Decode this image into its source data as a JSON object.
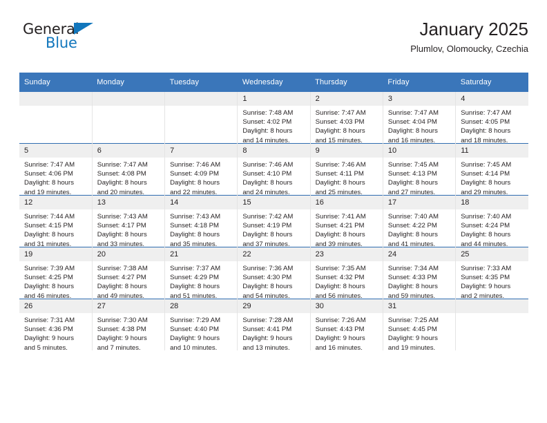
{
  "logo": {
    "text_primary": "General",
    "text_secondary": "Blue",
    "triangle_color": "#1176bc"
  },
  "header": {
    "title": "January 2025",
    "subtitle": "Plumlov, Olomoucky, Czechia"
  },
  "theme": {
    "header_bg": "#3a76ba",
    "row_divider": "#2e6cb0",
    "daynum_bg": "#efefef",
    "text": "#231f20"
  },
  "calendar": {
    "weekday_headers": [
      "Sunday",
      "Monday",
      "Tuesday",
      "Wednesday",
      "Thursday",
      "Friday",
      "Saturday"
    ],
    "weeks": [
      [
        {
          "day": "",
          "lines": []
        },
        {
          "day": "",
          "lines": []
        },
        {
          "day": "",
          "lines": []
        },
        {
          "day": "1",
          "lines": [
            "Sunrise: 7:48 AM",
            "Sunset: 4:02 PM",
            "Daylight: 8 hours",
            "and 14 minutes."
          ]
        },
        {
          "day": "2",
          "lines": [
            "Sunrise: 7:47 AM",
            "Sunset: 4:03 PM",
            "Daylight: 8 hours",
            "and 15 minutes."
          ]
        },
        {
          "day": "3",
          "lines": [
            "Sunrise: 7:47 AM",
            "Sunset: 4:04 PM",
            "Daylight: 8 hours",
            "and 16 minutes."
          ]
        },
        {
          "day": "4",
          "lines": [
            "Sunrise: 7:47 AM",
            "Sunset: 4:05 PM",
            "Daylight: 8 hours",
            "and 18 minutes."
          ]
        }
      ],
      [
        {
          "day": "5",
          "lines": [
            "Sunrise: 7:47 AM",
            "Sunset: 4:06 PM",
            "Daylight: 8 hours",
            "and 19 minutes."
          ]
        },
        {
          "day": "6",
          "lines": [
            "Sunrise: 7:47 AM",
            "Sunset: 4:08 PM",
            "Daylight: 8 hours",
            "and 20 minutes."
          ]
        },
        {
          "day": "7",
          "lines": [
            "Sunrise: 7:46 AM",
            "Sunset: 4:09 PM",
            "Daylight: 8 hours",
            "and 22 minutes."
          ]
        },
        {
          "day": "8",
          "lines": [
            "Sunrise: 7:46 AM",
            "Sunset: 4:10 PM",
            "Daylight: 8 hours",
            "and 24 minutes."
          ]
        },
        {
          "day": "9",
          "lines": [
            "Sunrise: 7:46 AM",
            "Sunset: 4:11 PM",
            "Daylight: 8 hours",
            "and 25 minutes."
          ]
        },
        {
          "day": "10",
          "lines": [
            "Sunrise: 7:45 AM",
            "Sunset: 4:13 PM",
            "Daylight: 8 hours",
            "and 27 minutes."
          ]
        },
        {
          "day": "11",
          "lines": [
            "Sunrise: 7:45 AM",
            "Sunset: 4:14 PM",
            "Daylight: 8 hours",
            "and 29 minutes."
          ]
        }
      ],
      [
        {
          "day": "12",
          "lines": [
            "Sunrise: 7:44 AM",
            "Sunset: 4:15 PM",
            "Daylight: 8 hours",
            "and 31 minutes."
          ]
        },
        {
          "day": "13",
          "lines": [
            "Sunrise: 7:43 AM",
            "Sunset: 4:17 PM",
            "Daylight: 8 hours",
            "and 33 minutes."
          ]
        },
        {
          "day": "14",
          "lines": [
            "Sunrise: 7:43 AM",
            "Sunset: 4:18 PM",
            "Daylight: 8 hours",
            "and 35 minutes."
          ]
        },
        {
          "day": "15",
          "lines": [
            "Sunrise: 7:42 AM",
            "Sunset: 4:19 PM",
            "Daylight: 8 hours",
            "and 37 minutes."
          ]
        },
        {
          "day": "16",
          "lines": [
            "Sunrise: 7:41 AM",
            "Sunset: 4:21 PM",
            "Daylight: 8 hours",
            "and 39 minutes."
          ]
        },
        {
          "day": "17",
          "lines": [
            "Sunrise: 7:40 AM",
            "Sunset: 4:22 PM",
            "Daylight: 8 hours",
            "and 41 minutes."
          ]
        },
        {
          "day": "18",
          "lines": [
            "Sunrise: 7:40 AM",
            "Sunset: 4:24 PM",
            "Daylight: 8 hours",
            "and 44 minutes."
          ]
        }
      ],
      [
        {
          "day": "19",
          "lines": [
            "Sunrise: 7:39 AM",
            "Sunset: 4:25 PM",
            "Daylight: 8 hours",
            "and 46 minutes."
          ]
        },
        {
          "day": "20",
          "lines": [
            "Sunrise: 7:38 AM",
            "Sunset: 4:27 PM",
            "Daylight: 8 hours",
            "and 49 minutes."
          ]
        },
        {
          "day": "21",
          "lines": [
            "Sunrise: 7:37 AM",
            "Sunset: 4:29 PM",
            "Daylight: 8 hours",
            "and 51 minutes."
          ]
        },
        {
          "day": "22",
          "lines": [
            "Sunrise: 7:36 AM",
            "Sunset: 4:30 PM",
            "Daylight: 8 hours",
            "and 54 minutes."
          ]
        },
        {
          "day": "23",
          "lines": [
            "Sunrise: 7:35 AM",
            "Sunset: 4:32 PM",
            "Daylight: 8 hours",
            "and 56 minutes."
          ]
        },
        {
          "day": "24",
          "lines": [
            "Sunrise: 7:34 AM",
            "Sunset: 4:33 PM",
            "Daylight: 8 hours",
            "and 59 minutes."
          ]
        },
        {
          "day": "25",
          "lines": [
            "Sunrise: 7:33 AM",
            "Sunset: 4:35 PM",
            "Daylight: 9 hours",
            "and 2 minutes."
          ]
        }
      ],
      [
        {
          "day": "26",
          "lines": [
            "Sunrise: 7:31 AM",
            "Sunset: 4:36 PM",
            "Daylight: 9 hours",
            "and 5 minutes."
          ]
        },
        {
          "day": "27",
          "lines": [
            "Sunrise: 7:30 AM",
            "Sunset: 4:38 PM",
            "Daylight: 9 hours",
            "and 7 minutes."
          ]
        },
        {
          "day": "28",
          "lines": [
            "Sunrise: 7:29 AM",
            "Sunset: 4:40 PM",
            "Daylight: 9 hours",
            "and 10 minutes."
          ]
        },
        {
          "day": "29",
          "lines": [
            "Sunrise: 7:28 AM",
            "Sunset: 4:41 PM",
            "Daylight: 9 hours",
            "and 13 minutes."
          ]
        },
        {
          "day": "30",
          "lines": [
            "Sunrise: 7:26 AM",
            "Sunset: 4:43 PM",
            "Daylight: 9 hours",
            "and 16 minutes."
          ]
        },
        {
          "day": "31",
          "lines": [
            "Sunrise: 7:25 AM",
            "Sunset: 4:45 PM",
            "Daylight: 9 hours",
            "and 19 minutes."
          ]
        },
        {
          "day": "",
          "lines": []
        }
      ]
    ]
  }
}
